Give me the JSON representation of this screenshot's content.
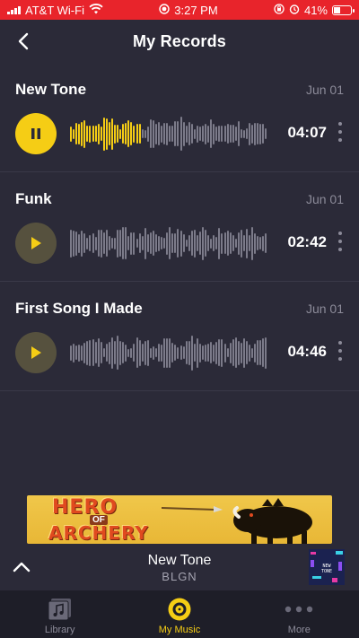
{
  "status_bar": {
    "carrier": "AT&T Wi-Fi",
    "time": "3:27 PM",
    "battery_percent": "41%",
    "battery_level": 0.41,
    "background_color": "#e8242b",
    "icons": [
      "signal-icon",
      "wifi-icon",
      "screen-record-icon",
      "orientation-lock-icon",
      "alarm-icon",
      "battery-charging-icon"
    ]
  },
  "header": {
    "title": "My Records",
    "back_icon": "chevron-left-icon"
  },
  "records": [
    {
      "name": "New Tone",
      "date": "Jun 01",
      "duration": "04:07",
      "state": "playing",
      "control_icon": "pause-icon",
      "progress": 0.35
    },
    {
      "name": "Funk",
      "date": "Jun 01",
      "duration": "02:42",
      "state": "paused",
      "control_icon": "play-icon",
      "progress": 0
    },
    {
      "name": "First Song I Made",
      "date": "Jun 01",
      "duration": "04:46",
      "state": "paused",
      "control_icon": "play-icon",
      "progress": 0
    }
  ],
  "ad": {
    "line1": "HERO",
    "line2": "OF",
    "line3": "ARCHERY"
  },
  "now_playing": {
    "title": "New Tone",
    "artist": "BLGN",
    "expand_icon": "chevron-up-icon",
    "artwork_text": "NEW TONE"
  },
  "tabs": [
    {
      "label": "Library",
      "icon": "library-music-icon",
      "active": false
    },
    {
      "label": "My Music",
      "icon": "vinyl-record-icon",
      "active": true
    },
    {
      "label": "More",
      "icon": "ellipsis-icon",
      "active": false
    }
  ],
  "colors": {
    "accent": "#f5cd15",
    "background": "#2b2a38",
    "tab_bar": "#1e1e28",
    "muted_text": "#8c8b99"
  }
}
